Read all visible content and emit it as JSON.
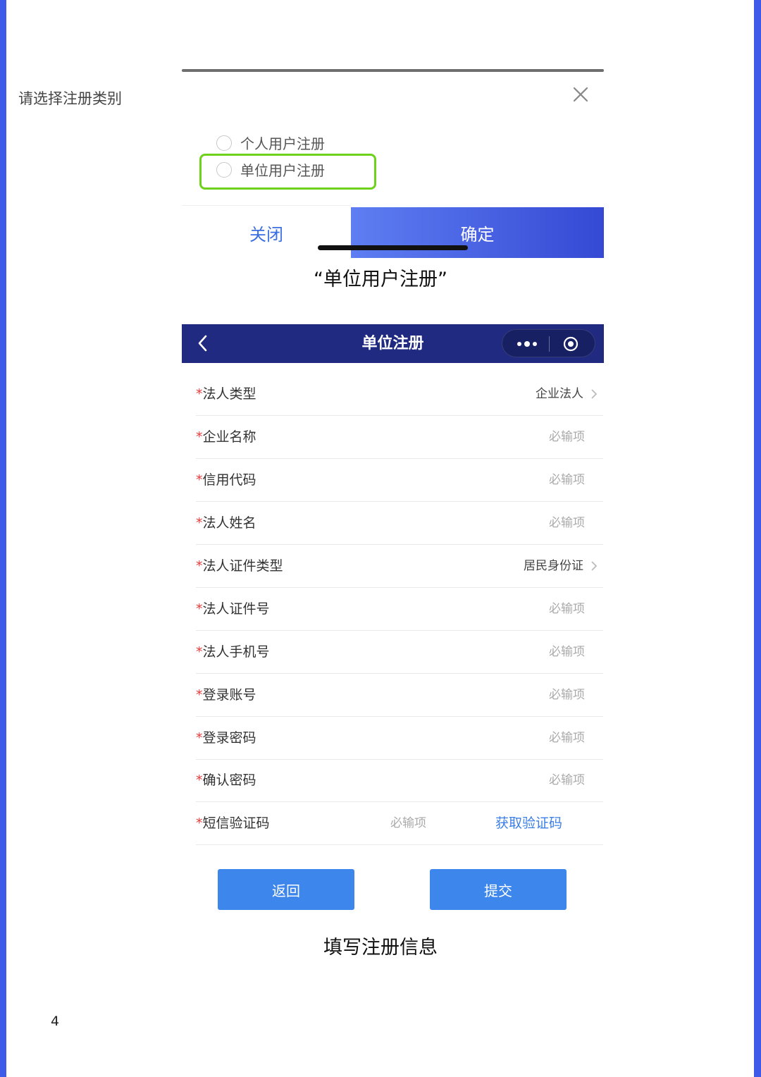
{
  "dialog": {
    "title": "请选择注册类别",
    "options": [
      {
        "label": "个人用户注册",
        "selected": false
      },
      {
        "label": "单位用户注册",
        "selected": false
      }
    ],
    "close_label": "关闭",
    "confirm_label": "确定",
    "icons": {
      "close": "close-icon",
      "highlight_color": "#6ed11c"
    }
  },
  "caption_top": "“单位用户注册”",
  "form_screen": {
    "nav_title": "单位注册",
    "icons": {
      "back": "chevron-left-icon",
      "more": "more-dots-icon",
      "target": "target-icon"
    },
    "required_mark": "*",
    "fields": [
      {
        "label": "法人类型",
        "value": "企业法人",
        "type": "select"
      },
      {
        "label": "企业名称",
        "placeholder": "必输项",
        "type": "input"
      },
      {
        "label": "信用代码",
        "placeholder": "必输项",
        "type": "input"
      },
      {
        "label": "法人姓名",
        "placeholder": "必输项",
        "type": "input"
      },
      {
        "label": "法人证件类型",
        "value": "居民身份证",
        "type": "select"
      },
      {
        "label": "法人证件号",
        "placeholder": "必输项",
        "type": "input"
      },
      {
        "label": "法人手机号",
        "placeholder": "必输项",
        "type": "input"
      },
      {
        "label": "登录账号",
        "placeholder": "必输项",
        "type": "input"
      },
      {
        "label": "登录密码",
        "placeholder": "必输项",
        "type": "input"
      },
      {
        "label": "确认密码",
        "placeholder": "必输项",
        "type": "input"
      }
    ],
    "sms": {
      "label": "短信验证码",
      "placeholder": "必输项",
      "link": "获取验证码"
    },
    "back_label": "返回",
    "submit_label": "提交",
    "colors": {
      "navbar": "#1f2a80",
      "button": "#3d86ec",
      "required": "#e83a3a",
      "link": "#3b7fe6"
    }
  },
  "caption_bottom": "填写注册信息",
  "page_number": "4"
}
